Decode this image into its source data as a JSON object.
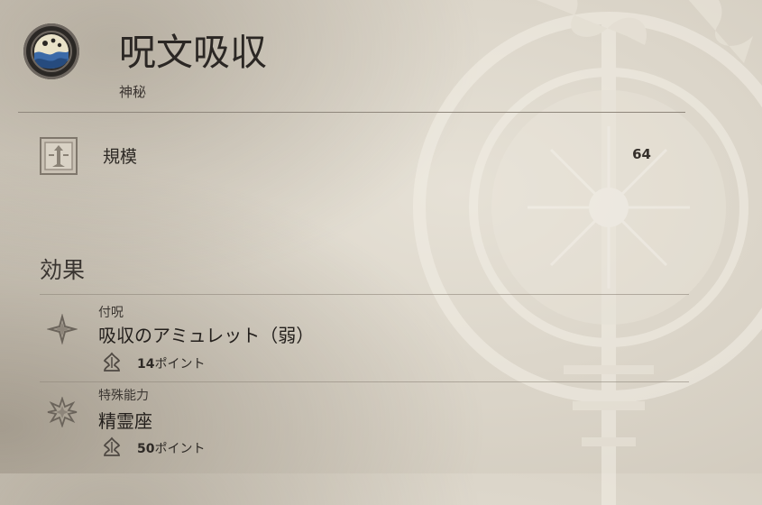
{
  "header": {
    "title": "呪文吸収",
    "subtitle": "神秘"
  },
  "stats": {
    "scale_label": "規模",
    "scale_value": "64"
  },
  "effects_section": {
    "title": "効果",
    "items": [
      {
        "category": "付呪",
        "name": "吸収のアミュレット（弱）",
        "points": "14",
        "points_unit": "ポイント",
        "icon": "compass-star-icon"
      },
      {
        "category": "特殊能力",
        "name": "精霊座",
        "points": "50",
        "points_unit": "ポイント",
        "icon": "star-burst-icon"
      }
    ]
  },
  "colors": {
    "parchment": "#dcd6ca",
    "ink": "#2a2521",
    "divider": "#8f877c",
    "emblem_blue": "#3b6aa8"
  }
}
